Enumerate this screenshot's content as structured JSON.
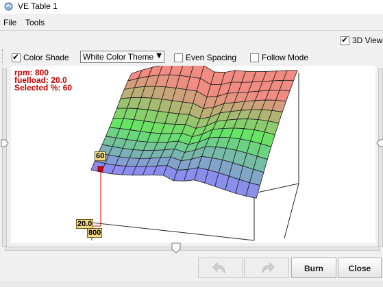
{
  "window": {
    "title": "VE Table 1"
  },
  "menu": {
    "file": "File",
    "tools": "Tools"
  },
  "view_3d": {
    "label": "3D View",
    "checked": true
  },
  "toolbar": {
    "color_shade": {
      "label": "Color Shade",
      "checked": true
    },
    "theme_select": {
      "value": "White Color Theme"
    },
    "even_spacing": {
      "label": "Even Spacing",
      "checked": false
    },
    "follow_mode": {
      "label": "Follow Mode",
      "checked": false
    }
  },
  "readout": {
    "rpm": "rpm: 800",
    "fuelload": "fuelload: 20.0",
    "selected": "Selected %: 60"
  },
  "axis_labels": {
    "value": "60",
    "fuelload": "20.0",
    "rpm": "800"
  },
  "buttons": {
    "undo_icon": "undo-arrow",
    "redo_icon": "redo-arrow",
    "burn": "Burn",
    "close": "Close"
  },
  "colors": {
    "readout": "#c00000",
    "selection": "#e00000"
  }
}
